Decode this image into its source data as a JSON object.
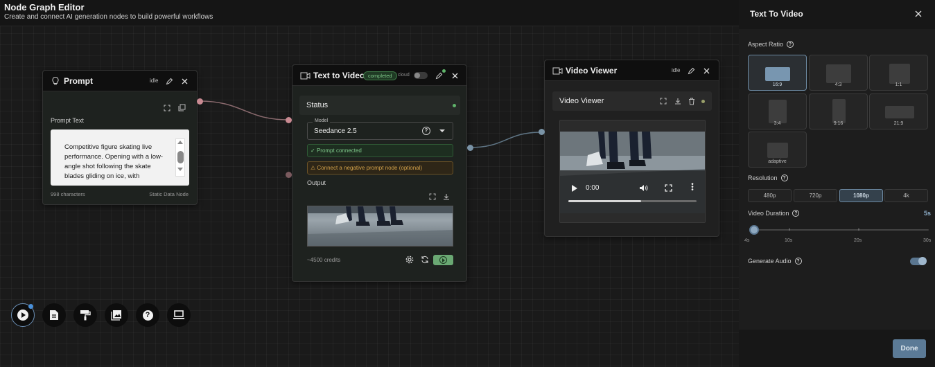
{
  "header": {
    "title": "Node Graph Editor",
    "subtitle": "Create and connect AI generation nodes to build powerful workflows"
  },
  "prompt_node": {
    "title": "Prompt",
    "status": "idle",
    "field_label": "Prompt Text",
    "text": "Competitive figure skating live performance. Opening with a low-angle shot following the skate blades gliding on ice, with",
    "char_count": "998 characters",
    "node_type": "Static Data Node"
  },
  "t2v_node": {
    "title": "Text to Video",
    "badge": "completed",
    "cloud_label": "cloud",
    "status_title": "Status",
    "model_label": "Model",
    "model_value": "Seedance 2.5",
    "prompt_connected": "Prompt connected",
    "negative_hint": "Connect a negative prompt node (optional)",
    "output_label": "Output",
    "credits": "~4500 credits"
  },
  "viewer_node": {
    "title": "Video Viewer",
    "status": "idle",
    "inner_title": "Video Viewer",
    "time": "0:00",
    "playback_progress": 0.57
  },
  "toolbar": {
    "buttons": [
      "play",
      "document",
      "paint-roller",
      "gallery",
      "help",
      "laptop"
    ]
  },
  "panel": {
    "title": "Text To Video",
    "aspect_ratio_label": "Aspect Ratio",
    "aspect_ratios": [
      "16:9",
      "4:3",
      "1:1",
      "3:4",
      "9:16",
      "21:9",
      "adaptive"
    ],
    "aspect_selected": "16:9",
    "resolution_label": "Resolution",
    "resolutions": [
      "480p",
      "720p",
      "1080p",
      "4k"
    ],
    "resolution_selected": "1080p",
    "duration_label": "Video Duration",
    "duration_value": "5s",
    "duration_ticks": [
      "4s",
      "10s",
      "20s",
      "30s"
    ],
    "audio_label": "Generate Audio",
    "audio_on": true,
    "done_label": "Done"
  },
  "colors": {
    "accent_blue": "#6d8aa3",
    "prompt_port": "#c98a92",
    "video_port": "#7a93a6",
    "success_green": "#5fb36a",
    "warning_amber": "#c99a3e"
  }
}
